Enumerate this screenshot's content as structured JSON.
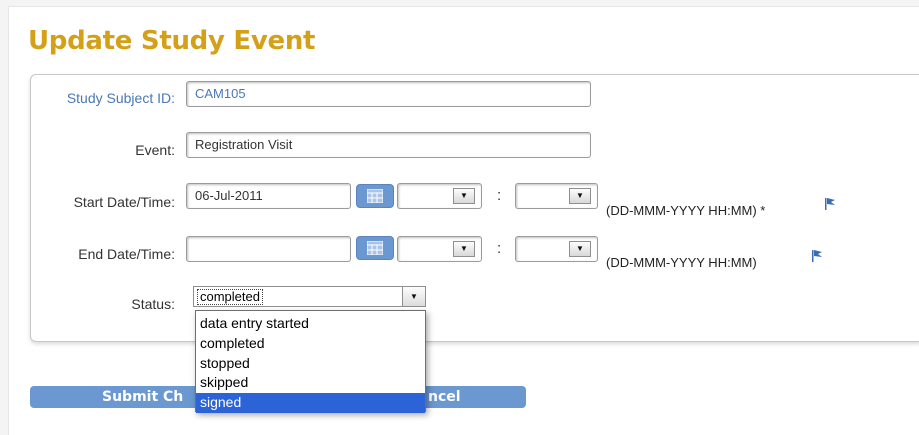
{
  "page": {
    "title": "Update Study Event"
  },
  "form": {
    "subject_id": {
      "label": "Study Subject ID:",
      "value": "CAM105"
    },
    "event": {
      "label": "Event:",
      "value": "Registration Visit"
    },
    "start": {
      "label": "Start Date/Time:",
      "date": "06-Jul-2011",
      "hour": "",
      "minute": "",
      "colon": ":",
      "format_hint": "(DD-MMM-YYYY HH:MM) *"
    },
    "end": {
      "label": "End Date/Time:",
      "date": "",
      "hour": "",
      "minute": "",
      "colon": ":",
      "format_hint": "(DD-MMM-YYYY HH:MM)"
    },
    "status": {
      "label": "Status:",
      "value": "completed",
      "options": [
        "data entry started",
        "completed",
        "stopped",
        "skipped",
        "signed"
      ],
      "highlighted_option": "signed"
    }
  },
  "buttons": {
    "submit_label": "Submit Ch",
    "cancel_label": "ncel"
  },
  "colors": {
    "title": "#d4a018",
    "accent": "#6b98d0",
    "highlight": "#2c63d6",
    "link": "#4a78b5"
  },
  "icons": {
    "calendar": "calendar-icon",
    "flag": "flag-icon",
    "dropdown": "chevron-down-icon"
  }
}
